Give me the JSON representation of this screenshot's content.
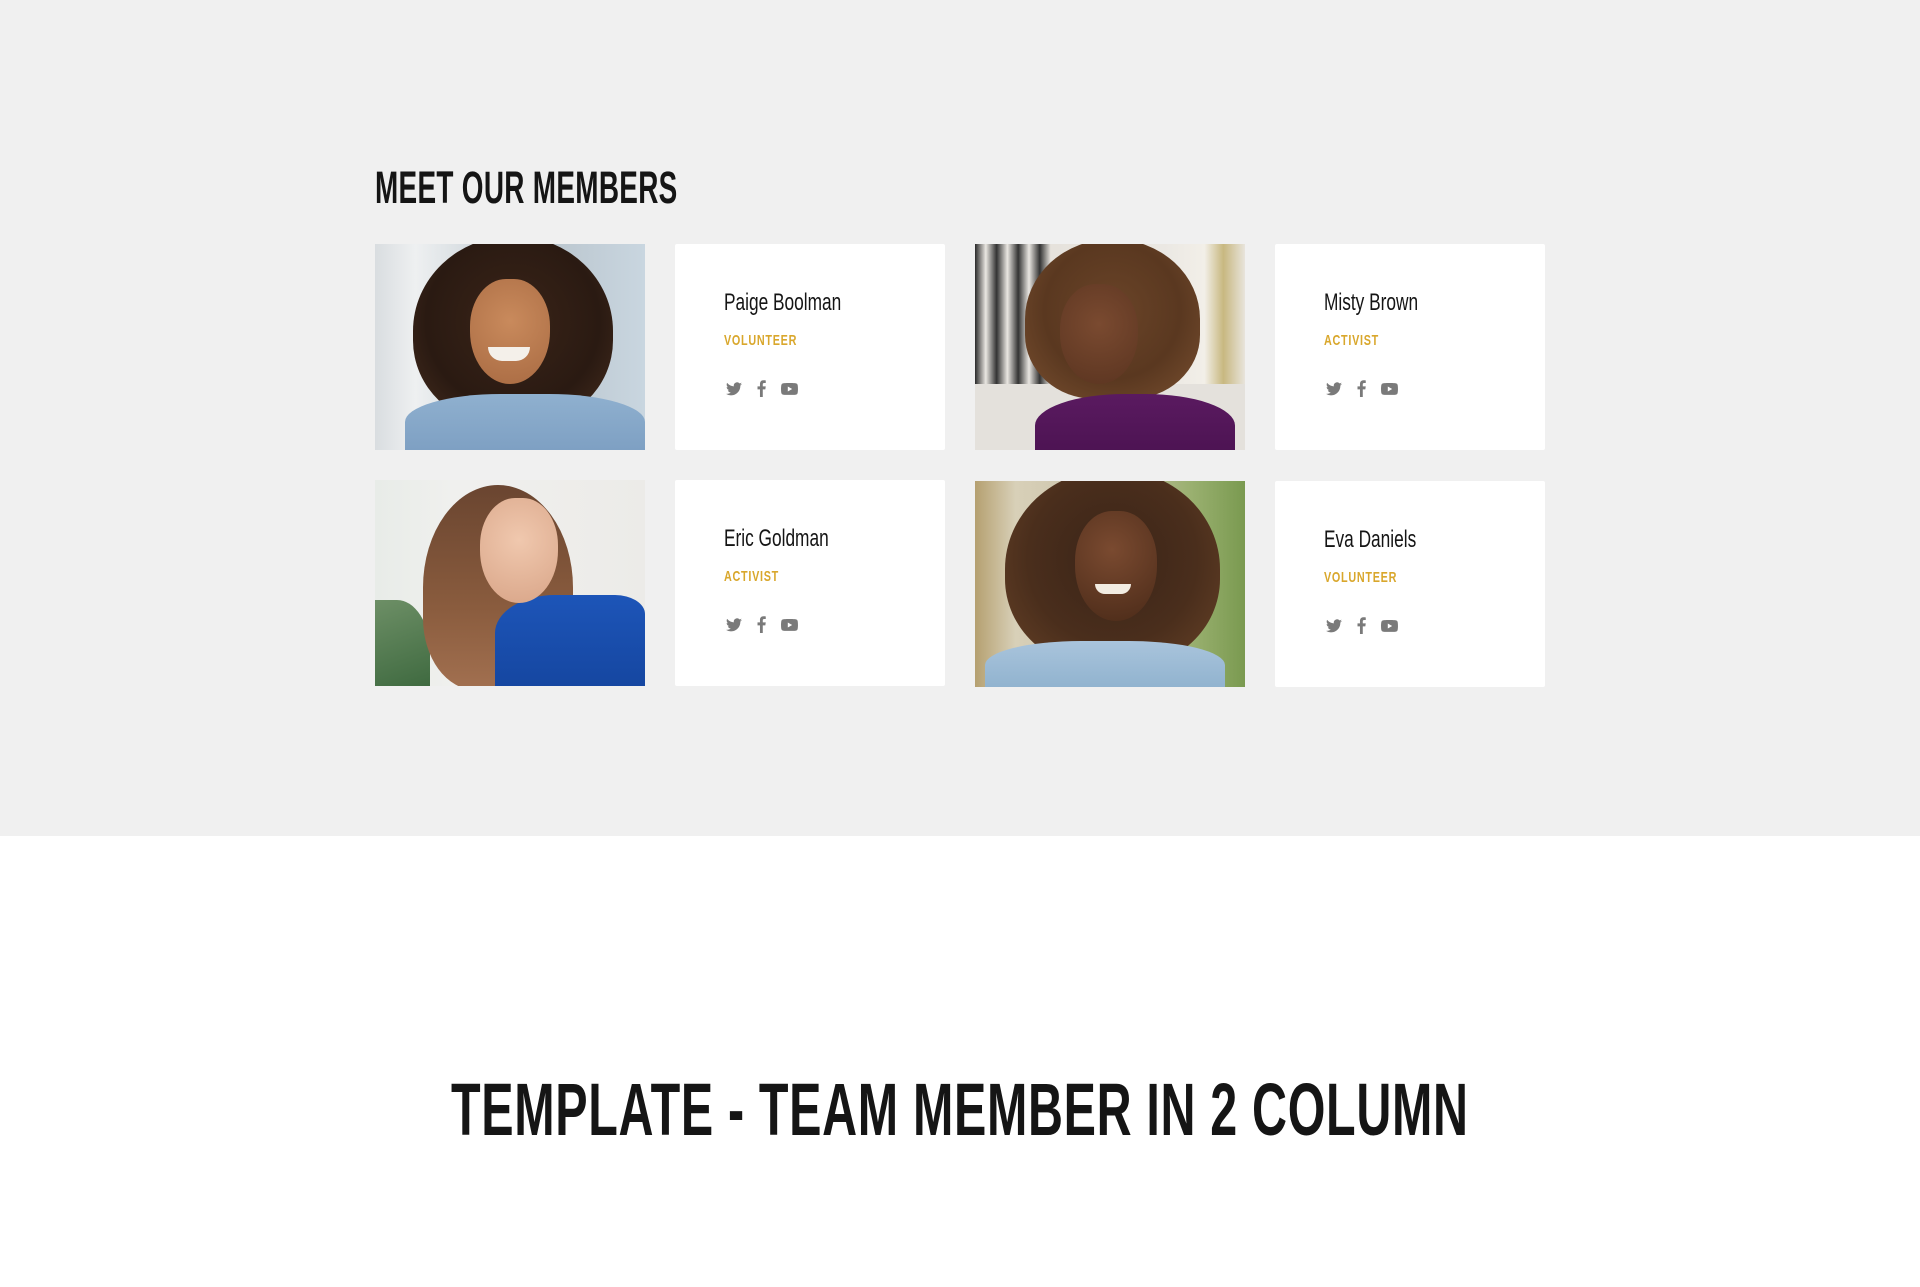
{
  "section": {
    "heading": "MEET OUR MEMBERS",
    "background_color": "#f0f0f0"
  },
  "accent_color": "#d9a72c",
  "members": [
    {
      "name": "Paige Boolman",
      "role": "VOLUNTEER",
      "photo_alt": "Smiling woman with curly hair in denim shirt",
      "socials": [
        "twitter-icon",
        "facebook-icon",
        "youtube-icon"
      ]
    },
    {
      "name": "Misty Brown",
      "role": "ACTIVIST",
      "photo_alt": "Woman with short curly hair in purple top",
      "socials": [
        "twitter-icon",
        "facebook-icon",
        "youtube-icon"
      ]
    },
    {
      "name": "Eric Goldman",
      "role": "ACTIVIST",
      "photo_alt": "Woman with long brown hair in blue top",
      "socials": [
        "twitter-icon",
        "facebook-icon",
        "youtube-icon"
      ]
    },
    {
      "name": "Eva Daniels",
      "role": "VOLUNTEER",
      "photo_alt": "Woman with curly hair smiling outdoors",
      "socials": [
        "twitter-icon",
        "facebook-icon",
        "youtube-icon"
      ]
    }
  ],
  "template_title": "TEMPLATE - TEAM MEMBER IN 2 COLUMN"
}
